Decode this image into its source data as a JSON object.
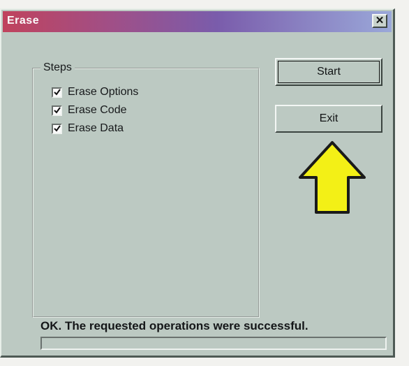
{
  "window": {
    "title": "Erase",
    "close_label": "✕"
  },
  "steps": {
    "label": "Steps",
    "items": [
      {
        "label": "Erase Options",
        "checked": true
      },
      {
        "label": "Erase Code",
        "checked": true
      },
      {
        "label": "Erase Data",
        "checked": true
      }
    ]
  },
  "buttons": {
    "start_label": "Start",
    "exit_label": "Exit"
  },
  "status": {
    "message": "OK. The requested operations were successful."
  },
  "colors": {
    "arrow_fill": "#f3f016",
    "arrow_outline": "#1a1a1a"
  }
}
